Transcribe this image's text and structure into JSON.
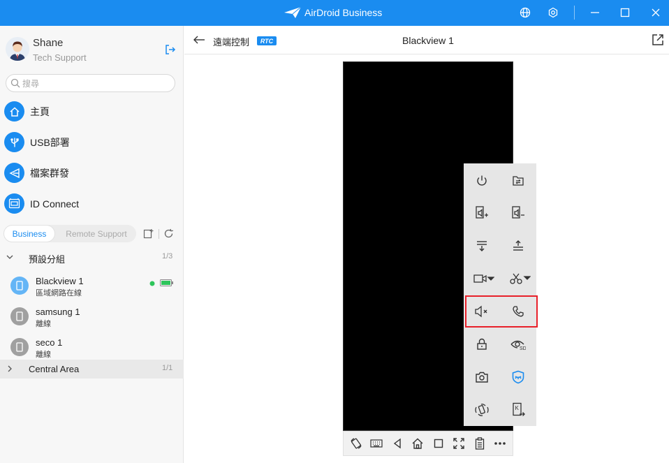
{
  "app": {
    "title": "AirDroid Business"
  },
  "titlebar": {
    "icons": [
      "globe-icon",
      "settings-gear-icon",
      "minimize-icon",
      "maximize-icon",
      "close-icon"
    ]
  },
  "user": {
    "name": "Shane",
    "role": "Tech Support"
  },
  "search": {
    "placeholder": "搜尋"
  },
  "nav": [
    {
      "label": "主頁",
      "icon": "home-icon"
    },
    {
      "label": "USB部署",
      "icon": "usb-icon"
    },
    {
      "label": "檔案群發",
      "icon": "send-icon"
    },
    {
      "label": "ID Connect",
      "icon": "id-connect-icon"
    }
  ],
  "tabs": {
    "active": "Business",
    "inactive": "Remote Support"
  },
  "groups": [
    {
      "name": "預設分組",
      "count": "1/3",
      "expanded": true
    },
    {
      "name": "Central Area",
      "count": "1/1",
      "expanded": false
    }
  ],
  "devices": [
    {
      "name": "Blackview 1",
      "status": "區域網路在線",
      "online": true
    },
    {
      "name": "samsung 1",
      "status": "離線",
      "online": false
    },
    {
      "name": "seco 1",
      "status": "離線",
      "online": false
    }
  ],
  "header": {
    "title": "遠端控制",
    "badge": "RTC",
    "device": "Blackview 1"
  },
  "colors": {
    "accent": "#1a8cf0",
    "highlight": "#e8202a",
    "online": "#2ec55b",
    "offline": "#999999"
  },
  "toolbar_icons": [
    "power-icon",
    "file-transfer-icon",
    "volume-up-icon",
    "volume-down-icon",
    "pull-down-notification-icon",
    "pull-up-icon",
    "record-video-icon",
    "screenshot-scissors-icon",
    "mute-icon",
    "phone-call-icon",
    "lock-icon",
    "black-screen-mode-icon",
    "camera-icon",
    "privacy-shield-icon",
    "rotate-vibrate-icon",
    "kiosk-exit-icon"
  ],
  "bottombar_icons": [
    "rotate-screen-icon",
    "keyboard-icon",
    "back-icon",
    "home-icon",
    "recents-icon",
    "fullscreen-icon",
    "clipboard-icon",
    "more-icon"
  ]
}
